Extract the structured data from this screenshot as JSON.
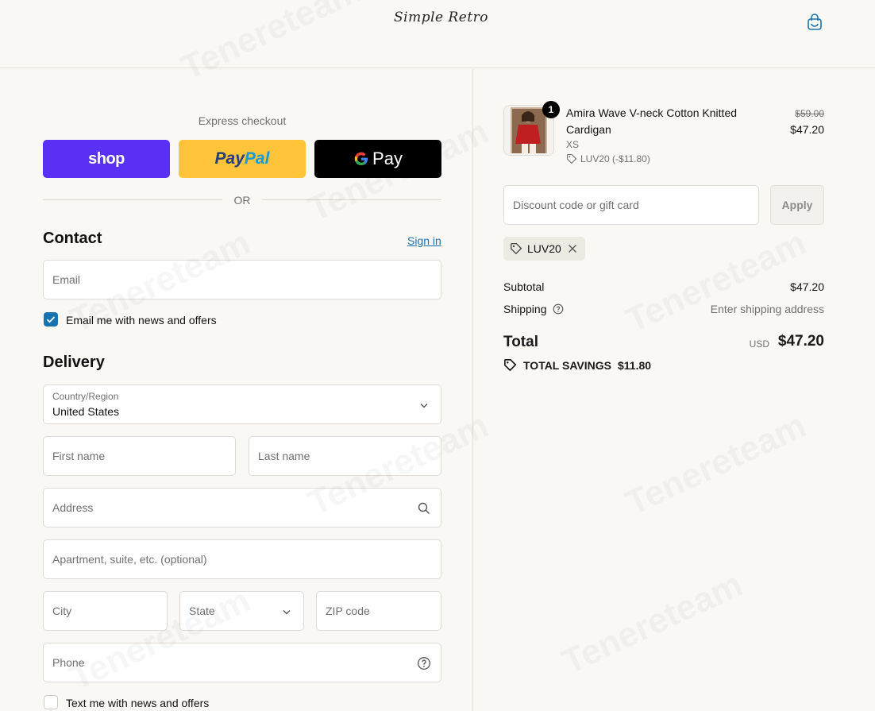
{
  "header": {
    "logo": "Simple Retro",
    "cart_icon": "shopping-bag-icon"
  },
  "express": {
    "title": "Express checkout",
    "shop_label": "shop",
    "paypal_label_1": "Pay",
    "paypal_label_2": "Pal",
    "gpay_label": "Pay",
    "or_label": "OR"
  },
  "contact": {
    "title": "Contact",
    "signin": "Sign in",
    "email_placeholder": "Email",
    "news_checkbox": "Email me with news and offers",
    "news_checked": true
  },
  "delivery": {
    "title": "Delivery",
    "country_label": "Country/Region",
    "country_value": "United States",
    "first_name": "First name",
    "last_name": "Last name",
    "address": "Address",
    "apartment": "Apartment, suite, etc. (optional)",
    "city": "City",
    "state": "State",
    "zip": "ZIP code",
    "phone": "Phone",
    "sms_checkbox": "Text me with news and offers",
    "sms_checked": false
  },
  "order": {
    "quantity": "1",
    "product_name": "Amira Wave V-neck Cotton Knitted Cardigan",
    "variant": "XS",
    "discount_line": "LUV20 (-$11.80)",
    "original_price": "$59.00",
    "price": "$47.20",
    "discount_placeholder": "Discount code or gift card",
    "apply_label": "Apply",
    "applied_code": "LUV20",
    "subtotal_label": "Subtotal",
    "subtotal_value": "$47.20",
    "shipping_label": "Shipping",
    "shipping_value": "Enter shipping address",
    "total_label": "Total",
    "total_currency": "USD",
    "total_value": "$47.20",
    "savings_label": "TOTAL SAVINGS",
    "savings_value": "$11.80"
  },
  "watermark": "Tenereteam",
  "colors": {
    "accent": "#1773b0",
    "shop": "#5a31f4",
    "paypal": "#ffc439",
    "gpay": "#000000",
    "background": "#faf8f5"
  }
}
